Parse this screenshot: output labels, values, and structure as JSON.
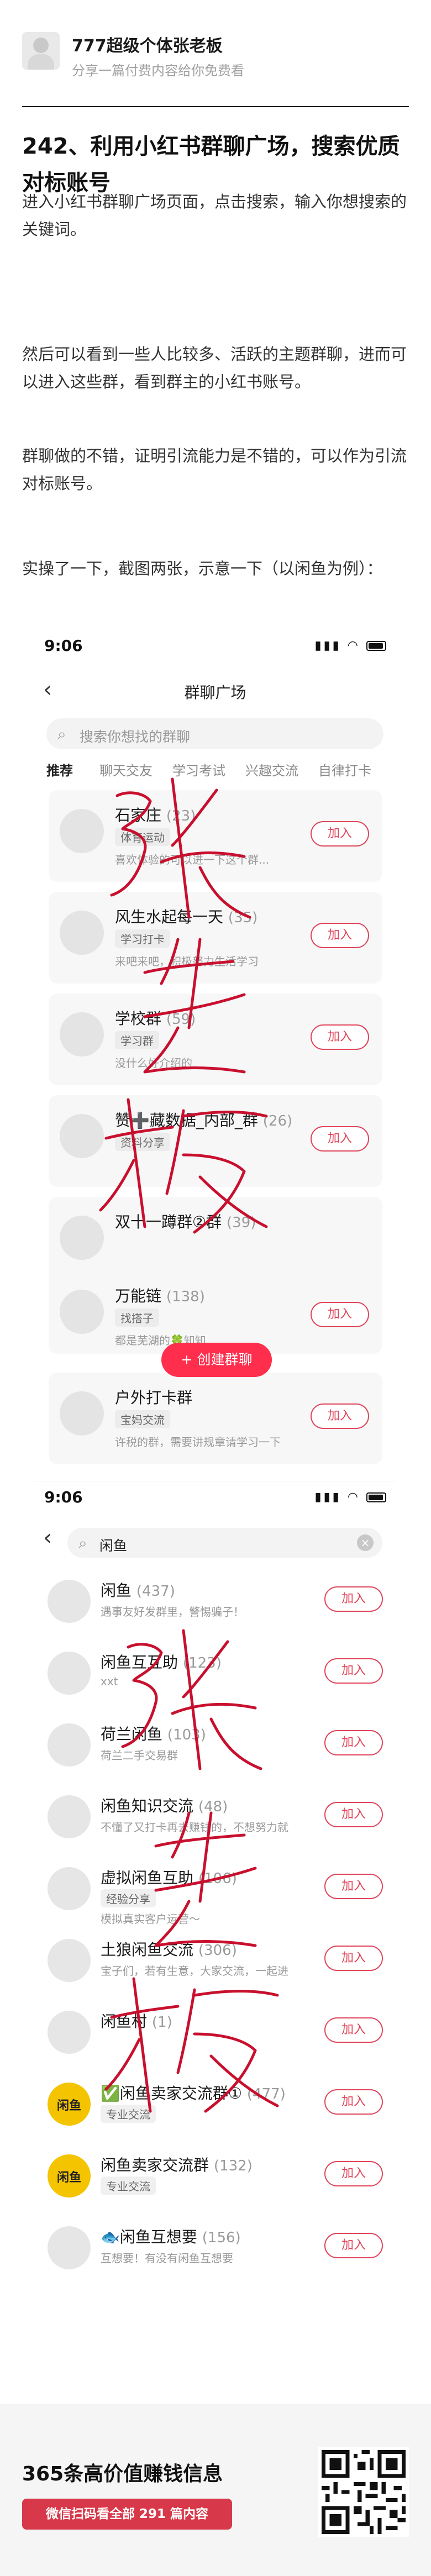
{
  "author": {
    "name": "777超级个体张老板",
    "desc": "分享一篇付费内容给你免费看"
  },
  "article": {
    "title": "242、利用小红书群聊广场，搜索优质对标账号",
    "paragraphs": [
      "进入小红书群聊广场页面，点击搜索，输入你想搜索的关键词。",
      "然后可以看到一些人比较多、活跃的主题群聊，进而可以进入这些群，看到群主的小红书账号。",
      "群聊做的不错，证明引流能力是不错的，可以作为引流对标账号。",
      "实操了一下，截图两张，示意一下（以闲鱼为例）："
    ]
  },
  "screenshot1": {
    "time": "9:06",
    "nav_title": "群聊广场",
    "search_placeholder": "搜索你想找的群聊",
    "tabs": [
      "推荐",
      "聊天交友",
      "学习考试",
      "兴趣交流",
      "自律打卡"
    ],
    "groups": [
      {
        "name": "石家庄",
        "count": "(23)",
        "tag": "体育运动",
        "desc": "喜欢体验的可以进一下这个群..."
      },
      {
        "name": "风生水起每一天",
        "count": "(35)",
        "tag": "学习打卡",
        "desc": "来吧来吧，积极努力生活学习"
      },
      {
        "name": "学校群",
        "count": "(59)",
        "tag": "学习群",
        "desc": "没什么好介绍的"
      },
      {
        "name": "赞➕藏数据_内部_群",
        "count": "(26)",
        "tag": "资料分享",
        "desc": ""
      },
      {
        "name": "双十一蹲群②群",
        "count": "(39)",
        "tag": "",
        "desc": ""
      },
      {
        "name": "万能链",
        "count": "(138)",
        "tag": "找搭子",
        "desc": "都是芜湖的🍀知知"
      },
      {
        "name": "户外打卡群",
        "count": "",
        "tag": "宝妈交流",
        "desc": "许税的群，需要讲规章请学习一下"
      }
    ],
    "join_label": "加入",
    "fab_label": "+ 创建群聊"
  },
  "screenshot2": {
    "time": "9:06",
    "search_value": "闲鱼",
    "results": [
      {
        "name": "闲鱼",
        "count": "(437)",
        "tag": "",
        "desc": "遇事友好发群里，警惕骗子！"
      },
      {
        "name": "闲鱼互互助",
        "count": "(123)",
        "tag": "",
        "desc": "xxt"
      },
      {
        "name": "荷兰闲鱼",
        "count": "(103)",
        "tag": "",
        "desc": "荷兰二手交易群"
      },
      {
        "name": "闲鱼知识交流",
        "count": "(48)",
        "tag": "",
        "desc": "不懂了又打卡再去赚钱的，不想努力就不要..."
      },
      {
        "name": "虚拟闲鱼互助",
        "count": "(106)",
        "tag": "经验分享",
        "desc": "模拟真实客户运营～"
      },
      {
        "name": "土狼闲鱼交流",
        "count": "(306)",
        "tag": "",
        "desc": "宝子们，若有生意，大家交流，一起进步..."
      },
      {
        "name": "闲鱼村",
        "count": "(1)",
        "tag": "",
        "desc": ""
      },
      {
        "name": "✅闲鱼卖家交流群①",
        "count": "(477)",
        "tag": "专业交流",
        "desc": ""
      },
      {
        "name": "闲鱼卖家交流群",
        "count": "(132)",
        "tag": "专业交流",
        "desc": ""
      },
      {
        "name": "🐟闲鱼互想要",
        "count": "(156)",
        "tag": "",
        "desc": "互想要！有没有闲鱼互想要"
      }
    ],
    "join_label": "加入"
  },
  "footer": {
    "title": "365条高价值赚钱信息",
    "button": "微信扫码看全部 291 篇内容"
  },
  "colors": {
    "accent": "#e0455a",
    "fab": "#ff2e4d",
    "footer_button": "#d7394a",
    "handwriting": "#c8102e"
  }
}
